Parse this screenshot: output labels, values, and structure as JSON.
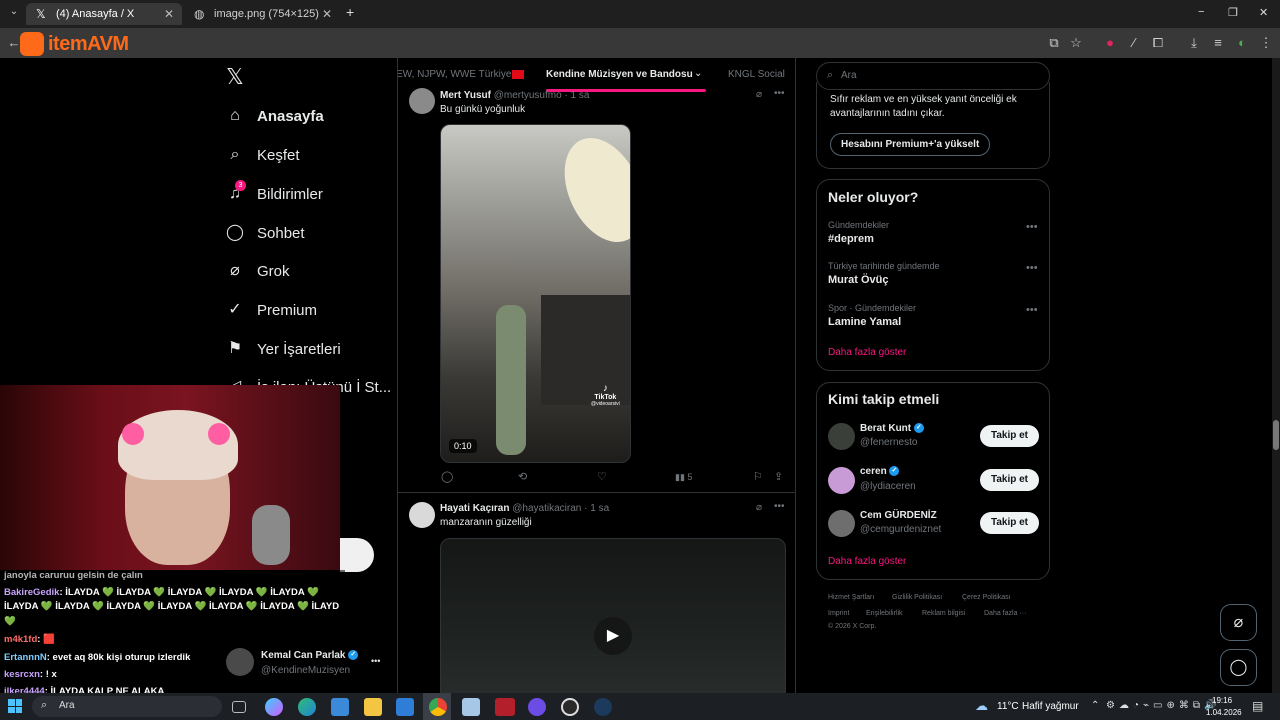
{
  "browser": {
    "tabs": [
      {
        "title": "(4) Anasayfa / X",
        "active": true
      },
      {
        "title": "image.png (754×125)",
        "active": false
      }
    ],
    "new_tab": "+",
    "window_controls": [
      "−",
      "❐",
      "✕"
    ]
  },
  "overlay_logo": {
    "text": "itemAVM"
  },
  "sidebar": {
    "logo": "𝕏",
    "items": [
      {
        "label": "Anasayfa",
        "icon": "home-icon",
        "glyph": "⌂",
        "bold": true
      },
      {
        "label": "Keşfet",
        "icon": "search-icon",
        "glyph": "⌕"
      },
      {
        "label": "Bildirimler",
        "icon": "bell-icon",
        "glyph": "🔔",
        "badge": "3"
      },
      {
        "label": "Sohbet",
        "icon": "chat-icon",
        "glyph": "◯"
      },
      {
        "label": "Grok",
        "icon": "grok-icon",
        "glyph": "⌀"
      },
      {
        "label": "Premium",
        "icon": "premium-icon",
        "glyph": "✓"
      },
      {
        "label": "Yer İşaretleri",
        "icon": "bookmark-icon",
        "glyph": "⚑"
      },
      {
        "label": "İş ilanı Üstünü İ St...",
        "icon": "briefcase-icon",
        "glyph": "◁"
      }
    ],
    "account": {
      "name": "Kemal Can Parlak",
      "handle": "@KendineMuzisyen",
      "more": "•••"
    }
  },
  "feed": {
    "tabs": [
      {
        "label": "EW, NJPW, WWE Türkiye",
        "active": false
      },
      {
        "label": "Kendine Müzisyen ve Bandosu",
        "active": true
      },
      {
        "label": "KNGL Social",
        "active": false
      }
    ],
    "posts": [
      {
        "author": "Mert Yusuf",
        "handle": "@mertyusufmo",
        "time": "· 1 sa",
        "text": "Bu günkü yoğunluk",
        "video_duration": "0:10",
        "watermark": "TikTok",
        "watermark_sub": "@videoarsivi",
        "views": "5"
      },
      {
        "author": "Hayati Kaçıran",
        "handle": "@hayatikaciran",
        "time": "· 1 sa",
        "text": "manzaranın güzelliği"
      }
    ]
  },
  "right": {
    "search_placeholder": "Ara",
    "premium": {
      "text": "Sıfır reklam ve en yüksek yanıt önceliği ek avantajlarının tadını çıkar.",
      "button": "Hesabını Premium+'a yükselt"
    },
    "trends": {
      "title": "Neler oluyor?",
      "items": [
        {
          "meta": "Gündemdekiler",
          "name": "#deprem"
        },
        {
          "meta": "Türkiye tarihinde gündemde",
          "name": "Murat Övüç"
        },
        {
          "meta": "Spor · Gündemdekiler",
          "name": "Lamine Yamal"
        }
      ],
      "more": "Daha fazla göster"
    },
    "who_to_follow": {
      "title": "Kimi takip etmeli",
      "users": [
        {
          "name": "Berat Kunt",
          "handle": "@fenernesto",
          "button": "Takip et"
        },
        {
          "name": "ceren",
          "handle": "@lydiaceren",
          "button": "Takip et"
        },
        {
          "name": "Cem GÜRDENİZ",
          "handle": "@cemgurdeniznet",
          "button": "Takip et"
        }
      ],
      "more": "Daha fazla göster"
    },
    "footer": [
      "Hizmet Şartları",
      "Gizlilik Politikası",
      "Çerez Politikası",
      "Imprint",
      "Erişilebilirlik",
      "Reklam bilgisi",
      "Daha fazla ···",
      "© 2026 X Corp."
    ]
  },
  "chat": {
    "lines": [
      {
        "user": "",
        "text": "janoyla caruruu gelsin de çalın",
        "color": "#ffffff"
      },
      {
        "user": "BakireGedik",
        "text": ": İLAYDA 💚 İLAYDA 💚 İLAYDA 💚 İLAYDA 💚 İLAYDA 💚",
        "color": "#c9a4ff"
      },
      {
        "user": "",
        "text": "İLAYDA 💚 İLAYDA 💚 İLAYDA 💚 İLAYDA 💚 İLAYDA 💚 İLAYDA 💚 İLAYD",
        "color": "#ffffff"
      },
      {
        "user": "",
        "text": "💚",
        "color": "#ffffff"
      },
      {
        "user": "m4k1fd",
        "text": ": 🟥",
        "color": "#ff6b6b"
      },
      {
        "user": "ErtannnN",
        "text": ": evet aq 80k kişi oturup izlerdik",
        "color": "#7fd0ff"
      },
      {
        "user": "kesrcxn",
        "text": ": ! x",
        "color": "#c9a4ff"
      },
      {
        "user": "ilker4444",
        "text": ": İLAYDA KALP NE ALAKA",
        "color": "#c9a4ff"
      }
    ]
  },
  "taskbar": {
    "search": "Ara",
    "weather": "11°C",
    "weather_desc": "Hafif yağmur",
    "time": "19:16",
    "date": "1.04.2026"
  },
  "colors": {
    "accent": "#f91880",
    "bg": "#000000",
    "border": "#2f3336",
    "blue": "#1d9bf0"
  }
}
